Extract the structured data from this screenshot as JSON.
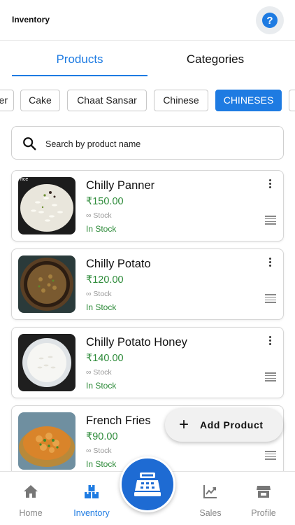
{
  "header": {
    "title": "Inventory",
    "help_icon": "help-icon"
  },
  "tabs": [
    {
      "label": "Products",
      "active": true
    },
    {
      "label": "Categories",
      "active": false
    }
  ],
  "categories": [
    {
      "label": "er",
      "active": false
    },
    {
      "label": "Cake",
      "active": false
    },
    {
      "label": "Chaat Sansar",
      "active": false
    },
    {
      "label": "Chinese",
      "active": false
    },
    {
      "label": "CHINESES",
      "active": true
    },
    {
      "label": "",
      "active": false
    }
  ],
  "search": {
    "placeholder": "Search by product name"
  },
  "products": [
    {
      "name": "Chilly Panner",
      "price": "₹150.00",
      "stock": "∞ Stock",
      "status": "In Stock",
      "thumb_text": "rice"
    },
    {
      "name": "Chilly Potato",
      "price": "₹120.00",
      "stock": "∞ Stock",
      "status": "In Stock"
    },
    {
      "name": "Chilly Potato Honey",
      "price": "₹140.00",
      "stock": "∞ Stock",
      "status": "In Stock"
    },
    {
      "name": "French Fries",
      "price": "₹90.00",
      "stock": "∞ Stock",
      "status": "In Stock"
    }
  ],
  "fab": {
    "label": "Add Product"
  },
  "nav": [
    {
      "label": "Home",
      "icon": "home-icon",
      "active": false
    },
    {
      "label": "Inventory",
      "icon": "inventory-icon",
      "active": true
    },
    {
      "label": "Sales",
      "icon": "sales-chart-icon",
      "active": false
    },
    {
      "label": "Profile",
      "icon": "store-icon",
      "active": false
    }
  ],
  "colors": {
    "accent": "#1e7be2",
    "price_green": "#2e8b3a",
    "pos_button": "#1e6bd3"
  }
}
